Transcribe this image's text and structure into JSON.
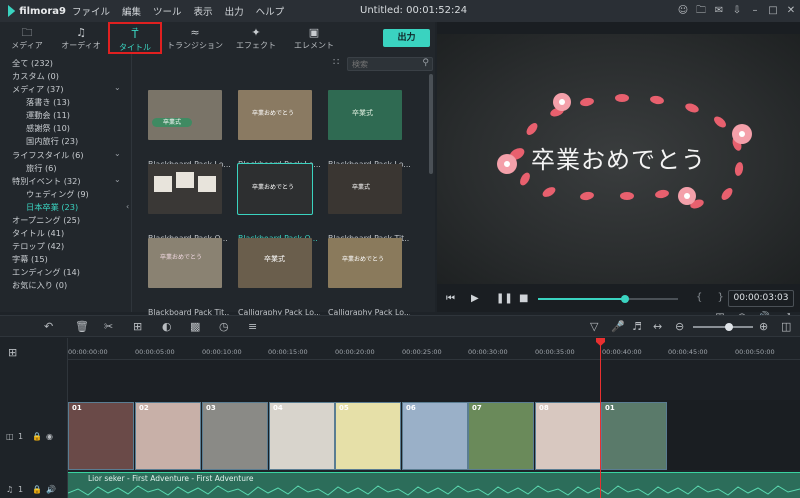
{
  "app": {
    "name": "filmora9",
    "doc_title": "Untitled:  00:01:52:24"
  },
  "menu": [
    "ファイル",
    "編集",
    "ツール",
    "表示",
    "出力",
    "ヘルプ"
  ],
  "title_icons": [
    "user-icon",
    "folder-icon",
    "mail-icon",
    "download-icon",
    "minimize-icon",
    "restore-icon",
    "close-icon"
  ],
  "tabs": [
    {
      "label": "メディア",
      "icon": "folder-icon"
    },
    {
      "label": "オーディオ",
      "icon": "music-note-icon"
    },
    {
      "label": "タイトル",
      "icon": "title-text-icon",
      "active": true
    },
    {
      "label": "トランジション",
      "icon": "transition-icon"
    },
    {
      "label": "エフェクト",
      "icon": "effects-icon"
    },
    {
      "label": "エレメント",
      "icon": "element-image-icon"
    }
  ],
  "export_label": "出力",
  "search": {
    "placeholder": "検索"
  },
  "categories": [
    {
      "label": "全て (232)",
      "indent": 0
    },
    {
      "label": "カスタム (0)",
      "indent": 0
    },
    {
      "label": "メディア (37)",
      "indent": 0,
      "expand": true
    },
    {
      "label": "落書き (13)",
      "indent": 2
    },
    {
      "label": "運動会 (11)",
      "indent": 2
    },
    {
      "label": "感謝祭 (10)",
      "indent": 2
    },
    {
      "label": "国内旅行 (23)",
      "indent": 2
    },
    {
      "label": "ライフスタイル (6)",
      "indent": 0,
      "expand": true
    },
    {
      "label": "旅行 (6)",
      "indent": 1
    },
    {
      "label": "特別イベント (32)",
      "indent": 0,
      "expand": true
    },
    {
      "label": "ウェディング (9)",
      "indent": 1
    },
    {
      "label": "日本卒業 (23)",
      "indent": 1,
      "selected": true
    },
    {
      "label": "オープニング (25)",
      "indent": 0
    },
    {
      "label": "タイトル (41)",
      "indent": 0
    },
    {
      "label": "テロップ (42)",
      "indent": 0
    },
    {
      "label": "字幕 (15)",
      "indent": 0
    },
    {
      "label": "エンディング (14)",
      "indent": 0
    },
    {
      "label": "お気に入り (0)",
      "indent": 0
    }
  ],
  "thumbnails": [
    {
      "label": "Blackboard Pack Lo...",
      "overlay": "卒業式",
      "bg": "#7a7468"
    },
    {
      "label": "Blackboard Pack Lo...",
      "overlay": "卒業おめでとう",
      "bg": "#8a7a62"
    },
    {
      "label": "Blackboard Pack Lo...",
      "overlay": "卒業式",
      "bg": "#2f6a52"
    },
    {
      "label": "Blackboard Pack O...",
      "overlay": "",
      "bg": "#3a3836"
    },
    {
      "label": "Blackboard Pack O...",
      "overlay": "卒業おめでとう",
      "bg": "#2d2f30",
      "selected": true
    },
    {
      "label": "Blackboard Pack Tit...",
      "overlay": "卒業式",
      "bg": "#3a3632"
    },
    {
      "label": "Blackboard Pack Tit...",
      "overlay": "卒業おめでとう",
      "bg": "#8a8272"
    },
    {
      "label": "Calligraphy Pack Lo...",
      "overlay": "卒業式",
      "bg": "#6a5e4c"
    },
    {
      "label": "Calligraphy Pack Lo...",
      "overlay": "卒業おめでとう",
      "bg": "#8a7a5c"
    }
  ],
  "preview": {
    "greeting": "卒業おめでとう",
    "progress_fraction": 0.62,
    "timecode": "00:00:03:03"
  },
  "ruler_ticks": [
    "00:00:00:00",
    "00:00:05:00",
    "00:00:10:00",
    "00:00:15:00",
    "00:00:20:00",
    "00:00:25:00",
    "00:00:30:00",
    "00:00:35:00",
    "00:00:40:00",
    "00:00:45:00",
    "00:00:50:00"
  ],
  "video_clips": [
    {
      "num": "01",
      "bg": "#6a4a48"
    },
    {
      "num": "02",
      "bg": "#c8b0a8"
    },
    {
      "num": "03",
      "bg": "#8a8a86"
    },
    {
      "num": "04",
      "bg": "#d8d4cc"
    },
    {
      "num": "05",
      "bg": "#e6e0a8"
    },
    {
      "num": "06",
      "bg": "#9ab0c8"
    },
    {
      "num": "07",
      "bg": "#6a8a5a"
    },
    {
      "num": "08",
      "bg": "#d8c8c0"
    },
    {
      "num": "01",
      "bg": "#5a7a6a"
    }
  ],
  "tracks": {
    "video_label": "1",
    "audio_label": "1"
  },
  "audio_title": "Lior seker - First Adventure - First Adventure",
  "labels": {
    "thumb_preview_text": "卒業おめでとう"
  }
}
